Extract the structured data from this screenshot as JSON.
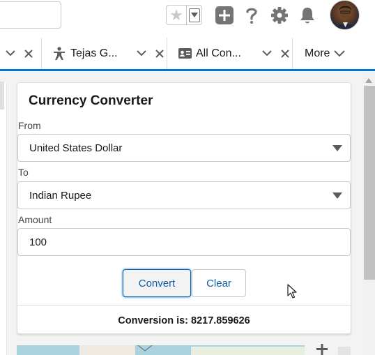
{
  "header": {
    "icons": [
      "favorite-star-icon",
      "favorites-menu-icon",
      "global-add-icon",
      "help-icon",
      "setup-gear-icon",
      "notifications-bell-icon",
      "user-avatar"
    ]
  },
  "tabs": [
    {
      "label": "",
      "icon": "chevron-down-icon"
    },
    {
      "label": "Tejas G...",
      "icon": "person-standing-icon"
    },
    {
      "label": "All Con...",
      "icon": "contact-card-icon"
    }
  ],
  "more_tab": {
    "label": "More"
  },
  "converter": {
    "title": "Currency Converter",
    "from_label": "From",
    "from_value": "United States Dollar",
    "to_label": "To",
    "to_value": "Indian Rupee",
    "amount_label": "Amount",
    "amount_value": "100",
    "convert_label": "Convert",
    "clear_label": "Clear",
    "result_text": "Conversion is: 8217.859626"
  },
  "colors": {
    "accent": "#0176d3",
    "button_text": "#0b5cab"
  }
}
